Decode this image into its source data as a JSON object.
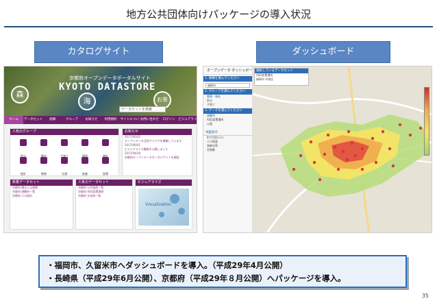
{
  "slide": {
    "title": "地方公共団体向けパッケージの導入状況",
    "page_number": "35"
  },
  "sections": {
    "catalog_label": "カタログサイト",
    "dashboard_label": "ダッシュボード"
  },
  "catalog": {
    "hero_subtitle": "京都府オープンデータポータルサイト",
    "hero_title": "KYOTO DATASTORE",
    "circles": [
      "森",
      "海",
      "お茶"
    ],
    "search_placeholder": "データセットを検索",
    "nav": [
      "ホーム",
      "データセット",
      "組織",
      "グループ",
      "お知らせ",
      "利用規約",
      "サイトについて",
      "お問い合わせ",
      "ログイン",
      "ビジュアライズ"
    ],
    "groups_heading": "人気のグループ",
    "groups": [
      "防災",
      "観光",
      "子育て",
      "環境",
      "福祉",
      "統計",
      "教育",
      "交通",
      "産業",
      "医療"
    ],
    "news_heading": "お知らせ",
    "news": [
      {
        "date": "2017/06/05",
        "text": "オープンデータ活用アイデアを募集しています"
      },
      {
        "date": "2017/06/01",
        "text": "ビジュアライズ機能を公開しました"
      },
      {
        "date": "2017/04/28",
        "text": "京都府オープンデータポータルサイトを開設"
      }
    ],
    "newest_heading": "新着データセット",
    "newest": [
      "京都府 観光入込客数",
      "京都府 避難所一覧",
      "京都府 人口統計"
    ],
    "popular_heading": "人気のデータセット",
    "popular": [
      "京都府 公共施設一覧",
      "京都府 AED設置場所",
      "京都府 文化財一覧"
    ],
    "viz_heading": "ビジュアライズ",
    "viz_caption": "Visualization"
  },
  "dashboard": {
    "app_title": "オープンデータ ダッシュボード",
    "steps": [
      "1. 組織を選んでください",
      "2. グループを選んでください",
      "3. データを選んでください"
    ],
    "org_value": "福岡市",
    "group_options": [
      "健康・福祉",
      "防災",
      "子育て"
    ],
    "data_options": [
      "避難所",
      "AED設置場所",
      "公園"
    ],
    "layer_heading": "地図表示",
    "layer_options": [
      "町丁目別人口",
      "人口密度",
      "高齢化率",
      "世帯数"
    ],
    "info_heading": "選択しているデータセット",
    "info_lines": [
      "AED設置場所",
      "福岡市 中央区"
    ],
    "legend_colors": [
      "#c9302c",
      "#f0ad4e",
      "#f7e463",
      "#9fd46a"
    ]
  },
  "summary": {
    "lines": [
      "・福岡市、久留米市へダッシュボードを導入。（平成29年4月公開）",
      "・長崎県（平成29年6月公開）、京都府（平成29年８月公開）へパッケージを導入。"
    ]
  }
}
